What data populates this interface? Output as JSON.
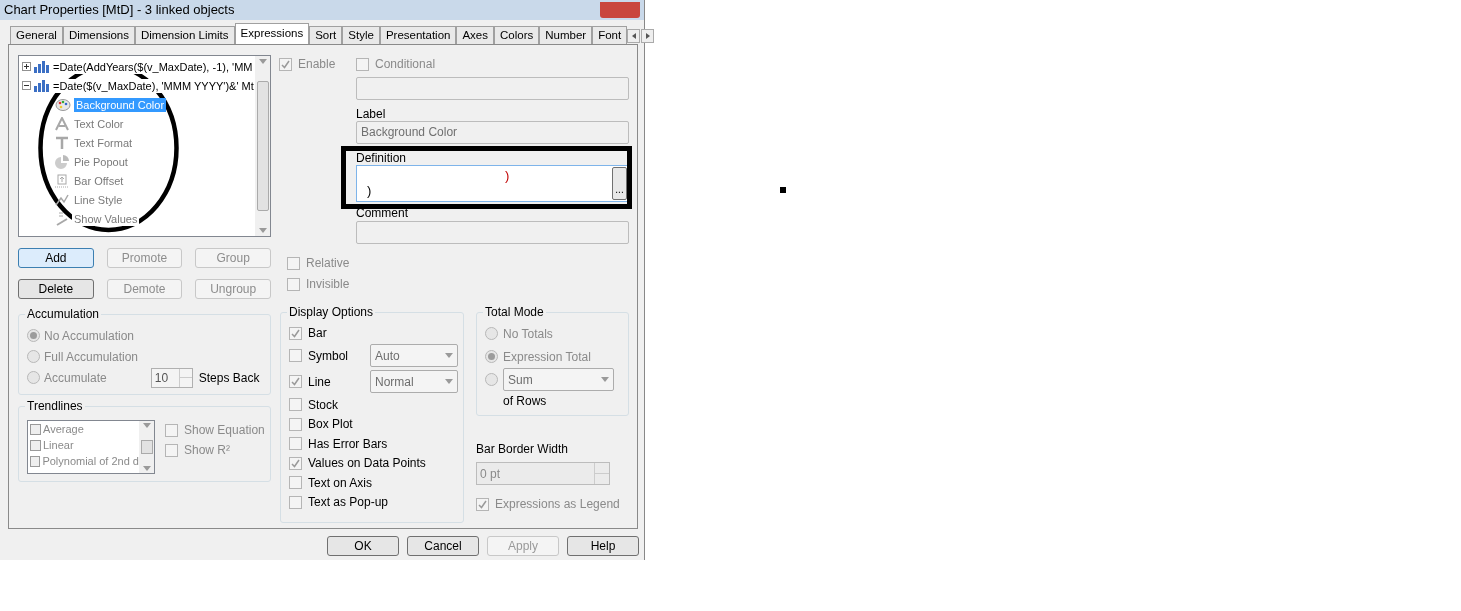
{
  "window": {
    "title": "Chart Properties [MtD] - 3 linked objects"
  },
  "tabs": [
    {
      "label": "General",
      "selected": false
    },
    {
      "label": "Dimensions",
      "selected": false
    },
    {
      "label": "Dimension Limits",
      "selected": false
    },
    {
      "label": "Expressions",
      "selected": true
    },
    {
      "label": "Sort",
      "selected": false
    },
    {
      "label": "Style",
      "selected": false
    },
    {
      "label": "Presentation",
      "selected": false
    },
    {
      "label": "Axes",
      "selected": false
    },
    {
      "label": "Colors",
      "selected": false
    },
    {
      "label": "Number",
      "selected": false
    },
    {
      "label": "Font",
      "selected": false
    }
  ],
  "expression_tree": [
    {
      "label": "=Date(AddYears($(v_MaxDate), -1), 'MM",
      "expanded": false
    },
    {
      "label": "=Date($(v_MaxDate), 'MMM YYYY')&' Mt",
      "expanded": true,
      "children": [
        {
          "kind": "palette",
          "label": "Background Color",
          "selected": true
        },
        {
          "kind": "letter",
          "label": "Text Color",
          "selected": false
        },
        {
          "kind": "format",
          "label": "Text Format",
          "selected": false
        },
        {
          "kind": "pie",
          "label": "Pie Popout",
          "selected": false
        },
        {
          "kind": "offset",
          "label": "Bar Offset",
          "selected": false
        },
        {
          "kind": "line",
          "label": "Line Style",
          "selected": false
        },
        {
          "kind": "value",
          "label": "Show Values",
          "selected": false
        }
      ]
    }
  ],
  "tree_buttons": [
    {
      "label": "Add",
      "disabled": false
    },
    {
      "label": "Promote",
      "disabled": true
    },
    {
      "label": "Group",
      "disabled": true
    },
    {
      "label": "Delete",
      "disabled": false
    },
    {
      "label": "Demote",
      "disabled": true
    },
    {
      "label": "Ungroup",
      "disabled": true
    }
  ],
  "accumulation": {
    "title": "Accumulation",
    "options": [
      {
        "label": "No Accumulation",
        "selected": true
      },
      {
        "label": "Full Accumulation",
        "selected": false
      },
      {
        "label": "Accumulate",
        "selected": false
      }
    ],
    "steps": "10",
    "steps_label": "Steps Back"
  },
  "trendlines": {
    "title": "Trendlines",
    "items": [
      {
        "label": "Average",
        "checked": false
      },
      {
        "label": "Linear",
        "checked": false
      },
      {
        "label": "Polynomial of 2nd d",
        "checked": false
      }
    ],
    "options": [
      {
        "label": "Show Equation",
        "checked": false
      },
      {
        "label": "Show R²",
        "checked": false
      }
    ]
  },
  "enable": {
    "label": "Enable",
    "checked": true
  },
  "conditional": {
    "label": "Conditional",
    "checked": false
  },
  "label_field": {
    "label": "Label",
    "value": "Background Color"
  },
  "definition": {
    "label": "Definition",
    "button": "...",
    "lines": [
      {
        "kind": "error",
        "text": ")"
      },
      {
        "kind": "plain",
        "text": ")"
      }
    ]
  },
  "comment": {
    "label": "Comment"
  },
  "relative": {
    "label": "Relative",
    "checked": false
  },
  "invisible": {
    "label": "Invisible",
    "checked": false
  },
  "display_options": {
    "title": "Display Options",
    "items": [
      {
        "kind": "check",
        "label": "Bar",
        "checked": true
      },
      {
        "kind": "select",
        "label": "Symbol",
        "checked": false,
        "value": "Auto"
      },
      {
        "kind": "select",
        "label": "Line",
        "checked": true,
        "value": "Normal"
      },
      {
        "kind": "check",
        "label": "Stock",
        "checked": false
      },
      {
        "kind": "check",
        "label": "Box Plot",
        "checked": false
      },
      {
        "kind": "check",
        "label": "Has Error Bars",
        "checked": false
      },
      {
        "kind": "check",
        "label": "Values on Data Points",
        "checked": true
      },
      {
        "kind": "check",
        "label": "Text on Axis",
        "checked": false
      },
      {
        "kind": "check",
        "label": "Text as Pop-up",
        "checked": false
      }
    ]
  },
  "total_mode": {
    "title": "Total Mode",
    "options": [
      {
        "kind": "radio",
        "label": "No Totals",
        "selected": false
      },
      {
        "kind": "radio",
        "label": "Expression Total",
        "selected": true
      },
      {
        "kind": "select",
        "value": "Sum",
        "selected": false
      }
    ],
    "suffix": "of Rows"
  },
  "bar_border_width": {
    "label": "Bar Border Width",
    "value": "0 pt"
  },
  "expressions_as_legend": {
    "label": "Expressions as Legend",
    "checked": true
  },
  "dialog_buttons": [
    {
      "label": "OK",
      "disabled": false
    },
    {
      "label": "Cancel",
      "disabled": false
    },
    {
      "label": "Apply",
      "disabled": true
    },
    {
      "label": "Help",
      "disabled": false
    }
  ]
}
